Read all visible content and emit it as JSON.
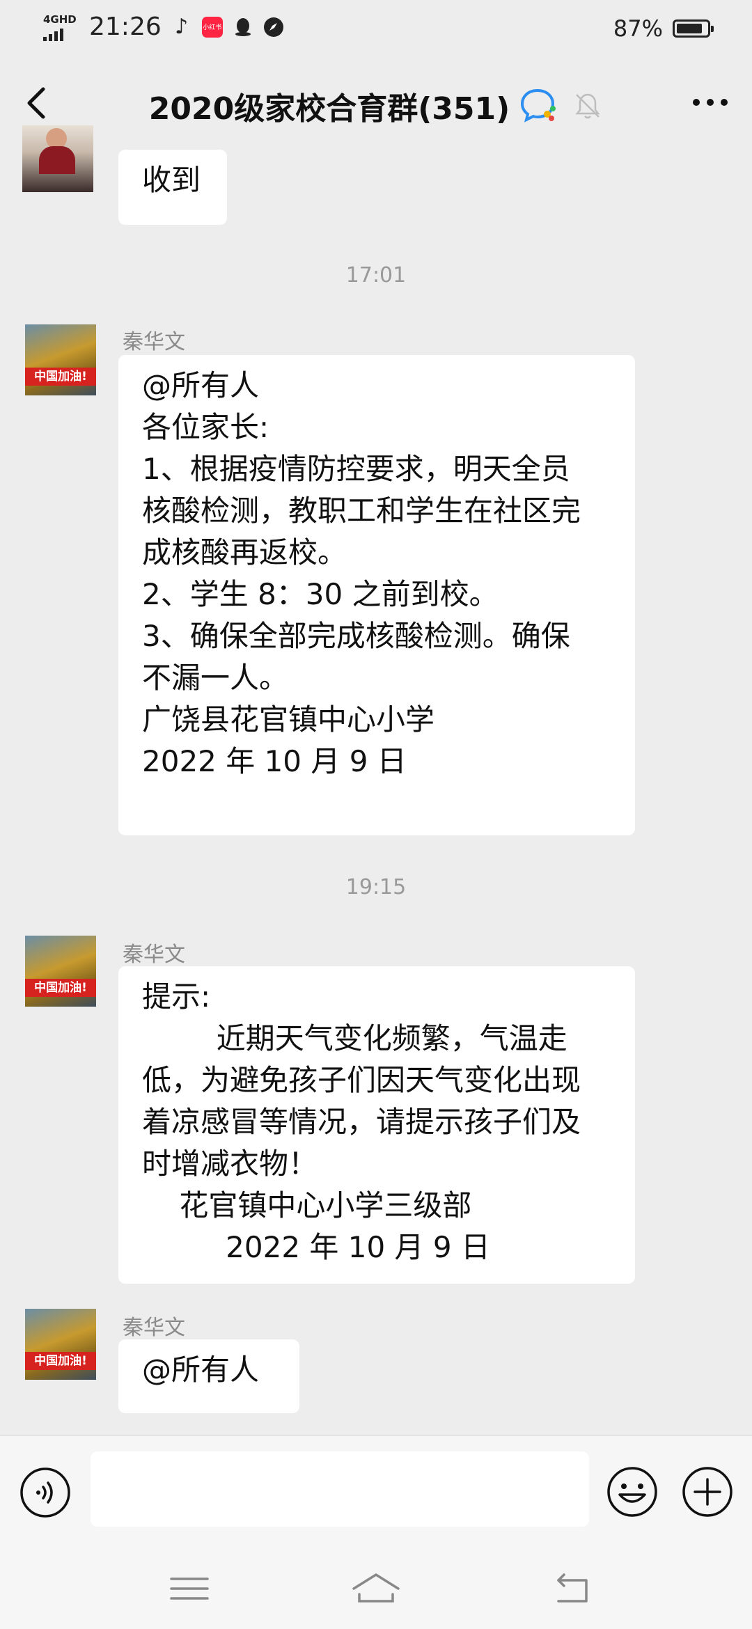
{
  "status_bar": {
    "network": "4GHD",
    "time": "21:26",
    "battery": "87%",
    "battery_level": 0.87,
    "notification_icons": [
      "tiktok-icon",
      "xiaohongshu-icon",
      "qq-icon",
      "compass-icon"
    ],
    "xiaohongshu_text": "小红书"
  },
  "header": {
    "title": "2020级家校合育群(351)"
  },
  "messages": [
    {
      "type": "text",
      "text": "收到"
    },
    {
      "type": "time",
      "text": "17:01"
    },
    {
      "type": "text",
      "sender": "秦华文",
      "avatar_text": "中国加油!",
      "lines": [
        "@所有人",
        "各位家长:",
        "1、根据疫情防控要求，明天全员",
        "核酸检测，教职工和学生在社区完",
        "成核酸再返校。",
        "2、学生 8：30 之前到校。",
        "3、确保全部完成核酸检测。确保",
        "不漏一人。",
        "",
        "广饶县花官镇中心小学",
        "2022 年 10 月 9 日"
      ]
    },
    {
      "type": "time",
      "text": "19:15"
    },
    {
      "type": "text",
      "sender": "秦华文",
      "avatar_text": "中国加油!",
      "lines": [
        "提示:",
        "        近期天气变化频繁，气温走",
        "低，为避免孩子们因天气变化出现",
        "着凉感冒等情况，请提示孩子们及",
        "时增减衣物！",
        "    花官镇中心小学三级部",
        "         2022 年 10 月 9 日"
      ]
    },
    {
      "type": "text",
      "sender": "秦华文",
      "avatar_text": "中国加油!",
      "lines": [
        "@所有人"
      ]
    }
  ],
  "input_bar": {
    "text_value": "",
    "voice_icon": "voice-icon",
    "emoji_icon": "emoji-icon",
    "plus_icon": "plus-icon"
  },
  "nav_bar": {
    "icons": [
      "menu-icon",
      "home-icon",
      "back-icon"
    ]
  },
  "colors": {
    "background": "#ededed",
    "bubble": "#ffffff",
    "timestamp": "#999999",
    "sender": "#8a8a8a"
  }
}
